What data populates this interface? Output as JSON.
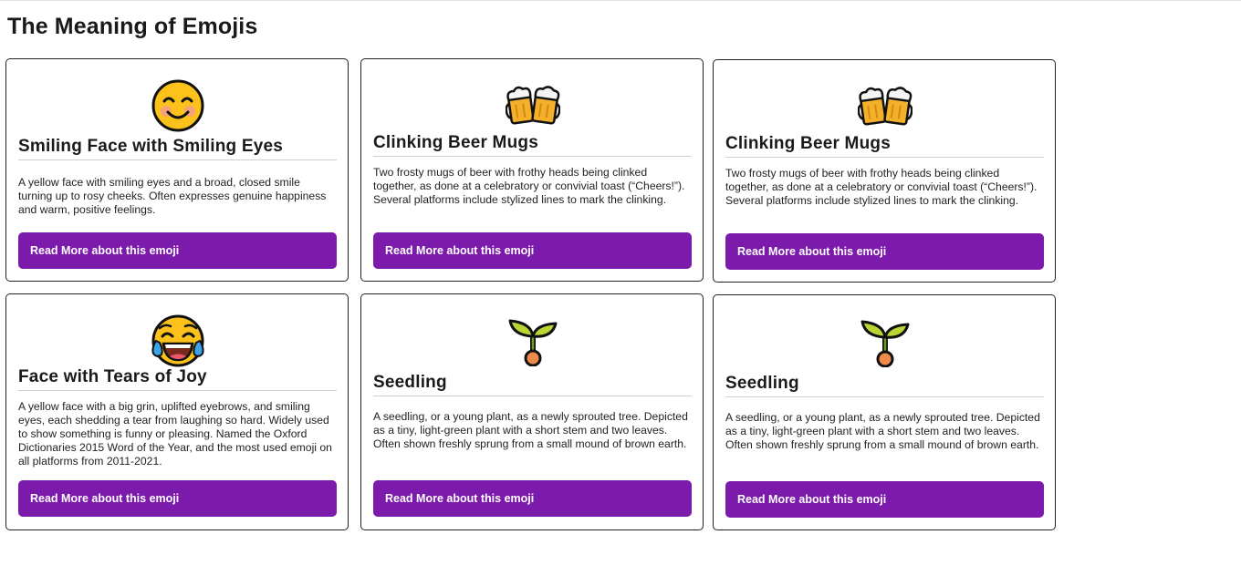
{
  "page": {
    "title": "The Meaning of Emojis"
  },
  "cards": [
    {
      "emoji": "smiling-face-with-smiling-eyes-icon",
      "title": "Smiling Face with Smiling Eyes",
      "description": "A yellow face with smiling eyes and a broad, closed smile turning up to rosy cheeks. Often expresses genuine happiness and warm, positive feelings.",
      "button_label": "Read More about this emoji"
    },
    {
      "emoji": "clinking-beer-mugs-icon",
      "title": "Clinking Beer Mugs",
      "description": "Two frosty mugs of beer with frothy heads being clinked together, as done at a celebratory or convivial toast (“Cheers!”). Several platforms include stylized lines to mark the clinking.",
      "button_label": "Read More about this emoji"
    },
    {
      "emoji": "clinking-beer-mugs-icon",
      "title": "Clinking Beer Mugs",
      "description": "Two frosty mugs of beer with frothy heads being clinked together, as done at a celebratory or convivial toast (“Cheers!”). Several platforms include stylized lines to mark the clinking.",
      "button_label": "Read More about this emoji"
    },
    {
      "emoji": "face-with-tears-of-joy-icon",
      "title": "Face with Tears of Joy",
      "description": "A yellow face with a big grin, uplifted eyebrows, and smiling eyes, each shedding a tear from laughing so hard. Widely used to show something is funny or pleasing. Named the Oxford Dictionaries 2015 Word of the Year, and the most used emoji on all platforms from 2011-2021.",
      "button_label": "Read More about this emoji"
    },
    {
      "emoji": "seedling-icon",
      "title": "Seedling",
      "description": "A seedling, or a young plant, as a newly sprouted tree. Depicted as a tiny, light-green plant with a short stem and two leaves. Often shown freshly sprung from a small mound of brown earth.",
      "button_label": "Read More about this emoji"
    },
    {
      "emoji": "seedling-icon",
      "title": "Seedling",
      "description": "A seedling, or a young plant, as a newly sprouted tree. Depicted as a tiny, light-green plant with a short stem and two leaves. Often shown freshly sprung from a small mound of brown earth.",
      "button_label": "Read More about this emoji"
    }
  ],
  "colors": {
    "button": "#7b1aab",
    "button_text": "#ffffff",
    "card_border": "#222222"
  }
}
